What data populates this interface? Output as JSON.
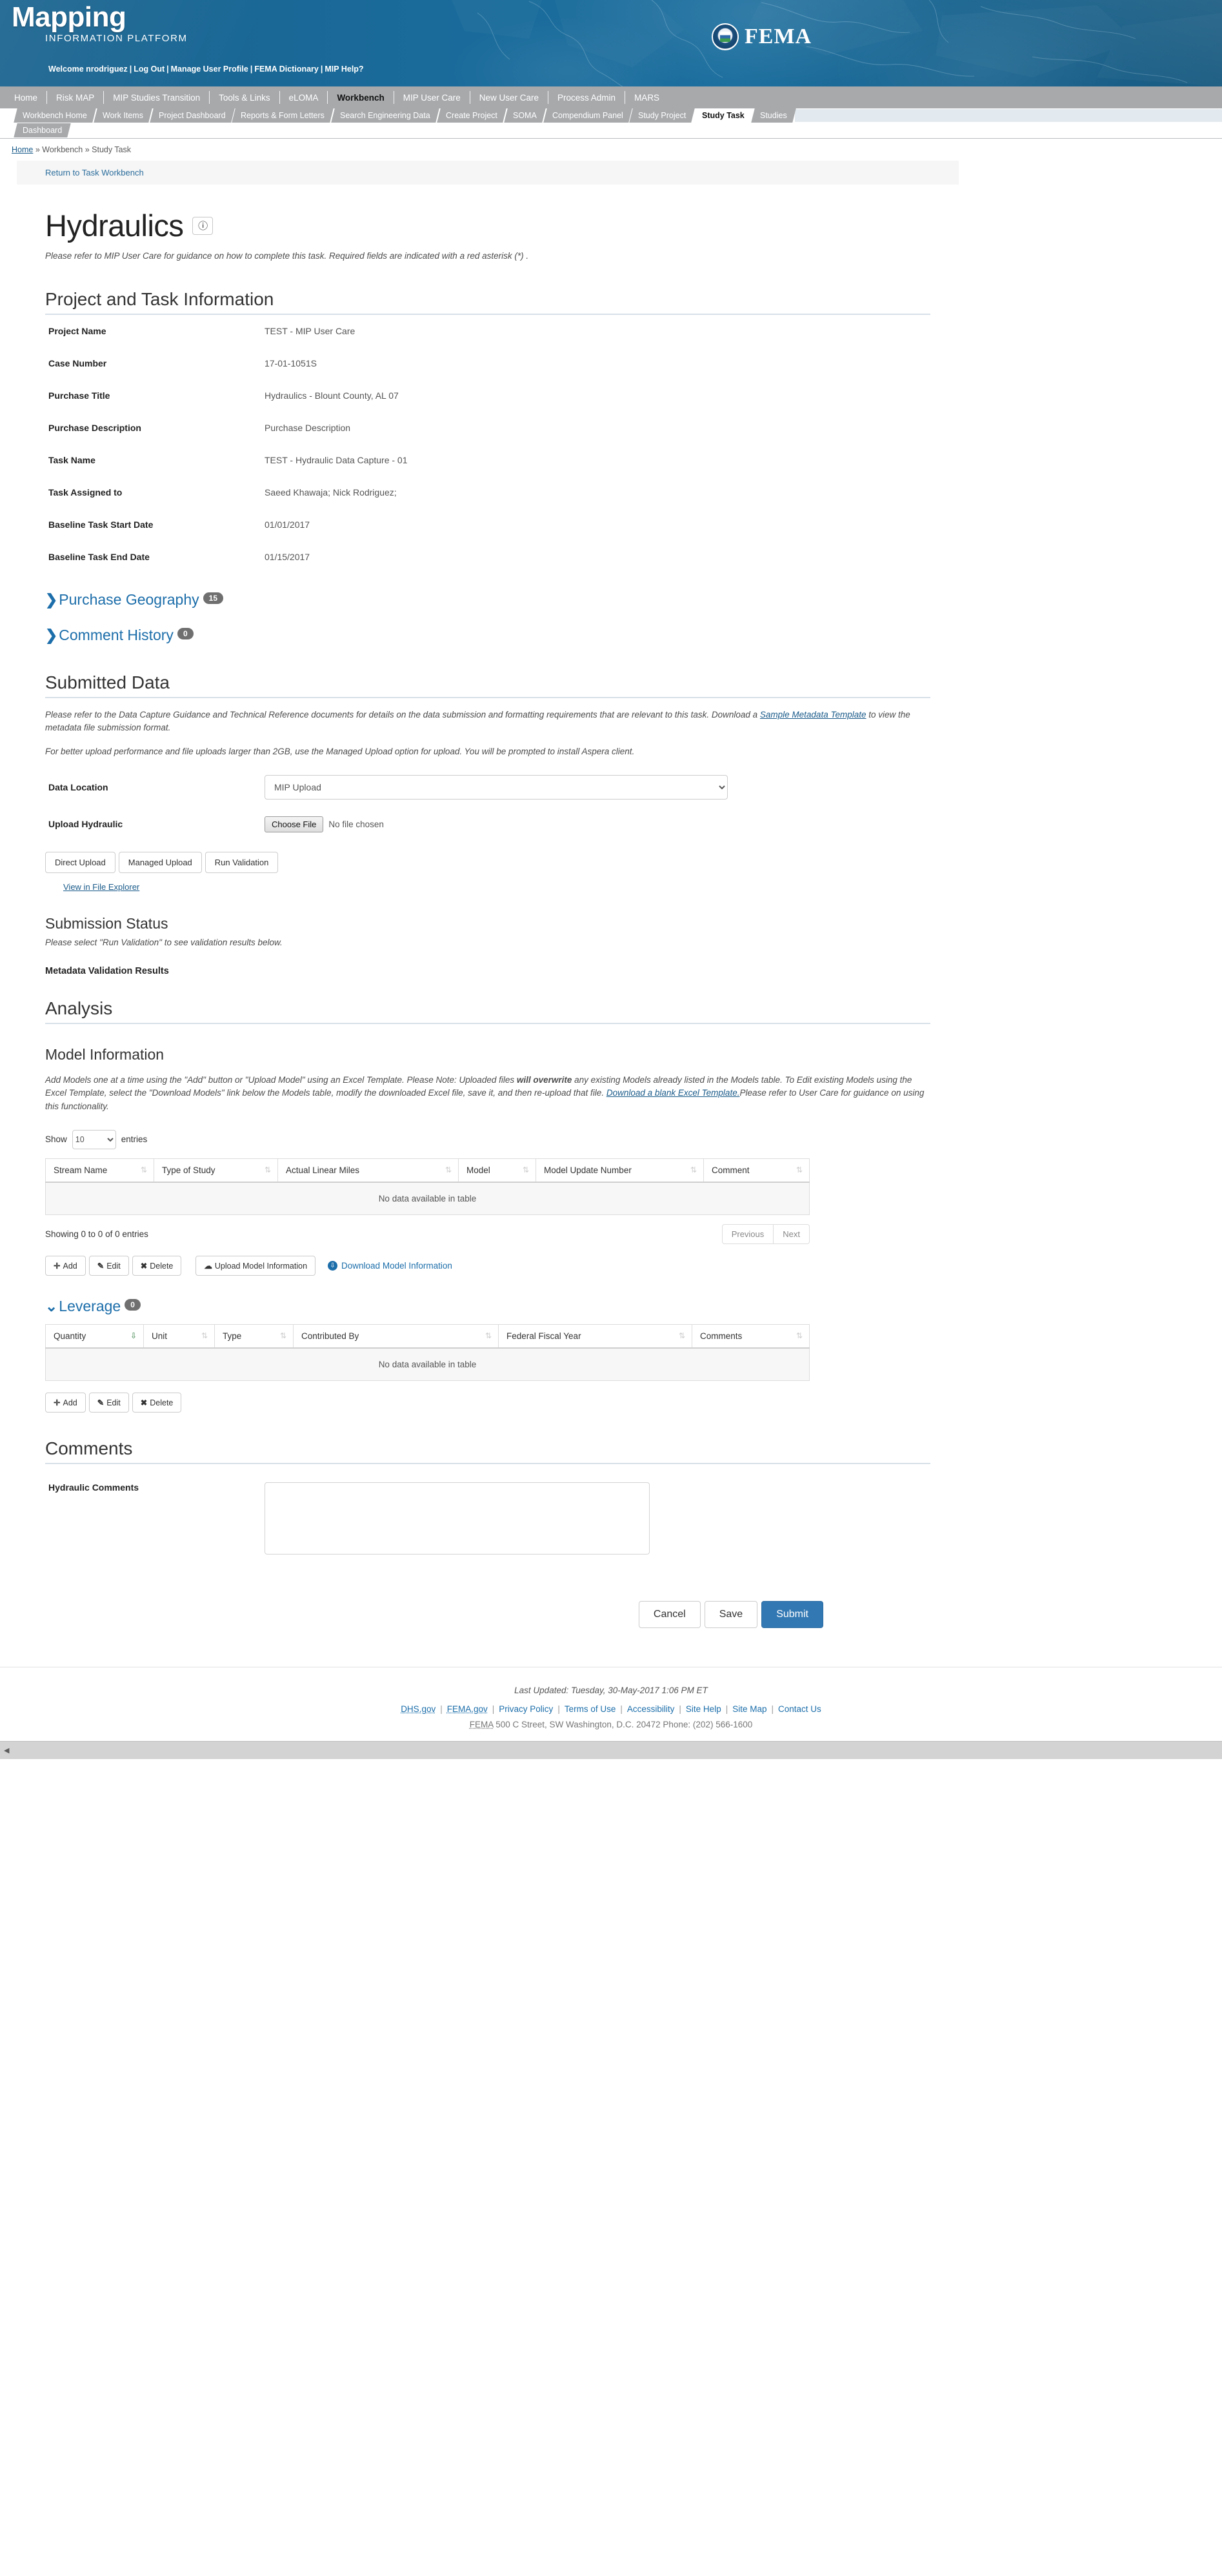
{
  "banner": {
    "brand_main": "Mapping",
    "brand_sub": "INFORMATION PLATFORM",
    "welcome": "Welcome nrodriguez",
    "logout": "Log Out",
    "manage_profile": "Manage User Profile",
    "fema_dictionary": "FEMA Dictionary",
    "mip_help": "MIP Help?",
    "agency": "FEMA"
  },
  "mainnav": [
    {
      "label": "Home",
      "active": false
    },
    {
      "label": "Risk MAP",
      "active": false
    },
    {
      "label": "MIP Studies Transition",
      "active": false
    },
    {
      "label": "Tools & Links",
      "active": false
    },
    {
      "label": "eLOMA",
      "active": false
    },
    {
      "label": "Workbench",
      "active": true
    },
    {
      "label": "MIP User Care",
      "active": false
    },
    {
      "label": "New User Care",
      "active": false
    },
    {
      "label": "Process Admin",
      "active": false
    },
    {
      "label": "MARS",
      "active": false
    }
  ],
  "subnav": [
    {
      "label": "Workbench Home",
      "active": false
    },
    {
      "label": "Work Items",
      "active": false
    },
    {
      "label": "Project Dashboard",
      "active": false
    },
    {
      "label": "Reports & Form Letters",
      "active": false
    },
    {
      "label": "Search Engineering Data",
      "active": false
    },
    {
      "label": "Create Project",
      "active": false
    },
    {
      "label": "SOMA",
      "active": false
    },
    {
      "label": "Compendium Panel",
      "active": false
    },
    {
      "label": "Study Project",
      "active": false
    },
    {
      "label": "Study Task",
      "active": true
    },
    {
      "label": "Studies",
      "active": false
    },
    {
      "label": "Dashboard",
      "active": false
    }
  ],
  "breadcrumb": {
    "home": "Home",
    "trail": "» Workbench » Study Task"
  },
  "return_bar": {
    "label": "Return to Task Workbench"
  },
  "page": {
    "title": "Hydraulics",
    "help_icon": "?",
    "lede": "Please refer to MIP User Care for guidance on how to complete this task. Required fields are indicated with a red asterisk (*) ."
  },
  "project_section": {
    "heading": "Project and Task Information",
    "fields": [
      {
        "label": "Project Name",
        "value": "TEST - MIP User Care"
      },
      {
        "label": "Case Number",
        "value": "17-01-1051S"
      },
      {
        "label": "Purchase Title",
        "value": "Hydraulics - Blount County, AL 07"
      },
      {
        "label": "Purchase Description",
        "value": "Purchase Description"
      },
      {
        "label": "Task Name",
        "value": "TEST - Hydraulic Data Capture - 01"
      },
      {
        "label": "Task Assigned to",
        "value": "Saeed Khawaja; Nick Rodriguez;"
      },
      {
        "label": "Baseline Task Start Date",
        "value": "01/01/2017"
      },
      {
        "label": "Baseline Task End Date",
        "value": "01/15/2017"
      }
    ]
  },
  "accordions": [
    {
      "label": "Purchase Geography",
      "count": "15",
      "caret": "❯"
    },
    {
      "label": "Comment History",
      "count": "0",
      "caret": "❯"
    }
  ],
  "submitted_data": {
    "heading": "Submitted Data",
    "note1_a": "Please refer to the Data Capture Guidance and Technical Reference documents for details on the data submission and formatting requirements that are relevant to this task. Download a ",
    "note1_link": "Sample Metadata Template",
    "note1_b": " to view the metadata file submission format.",
    "note2": "For better upload performance and file uploads larger than 2GB, use the Managed Upload option for upload. You will be prompted to install Aspera client.",
    "data_location_label": "Data Location",
    "data_location_value": "MIP Upload",
    "upload_label": "Upload Hydraulic",
    "choose_file_label": "Choose File",
    "no_file_text": "No file chosen",
    "buttons": [
      "Direct Upload",
      "Managed Upload",
      "Run Validation"
    ],
    "file_explorer_link": "View in File Explorer"
  },
  "submission_status": {
    "heading": "Submission Status",
    "note": "Please select \"Run Validation\" to see validation results below.",
    "metadata_heading": "Metadata Validation Results"
  },
  "analysis": {
    "heading": "Analysis",
    "model_heading": "Model Information",
    "model_note_a": "Add Models one at a time using the \"Add\" button or \"Upload Model\" using an Excel Template. Please Note: Uploaded files ",
    "model_note_bold": "will overwrite",
    "model_note_b": " any existing Models already listed in the Models table. To Edit existing Models using the Excel Template, select the \"Download Models\" link below the Models table, modify the downloaded Excel file, save it, and then re-upload that file. ",
    "model_note_link": "Download a blank Excel Template.",
    "model_note_c": "Please refer to User Care for guidance on using this functionality."
  },
  "models_table": {
    "show_label": "Show",
    "entries_label": "entries",
    "page_length": "10",
    "columns": [
      "Stream Name",
      "Type of Study",
      "Actual Linear Miles",
      "Model",
      "Model Update Number",
      "Comment"
    ],
    "empty_text": "No data available in table",
    "rows": [],
    "info": "Showing 0 to 0 of 0 entries",
    "prev": "Previous",
    "next": "Next",
    "actions": [
      "Add",
      "Edit",
      "Delete"
    ],
    "upload_label": "Upload Model Information",
    "download_label": "Download Model Information"
  },
  "leverage": {
    "label": "Leverage",
    "count": "0",
    "caret": "⌄",
    "columns": [
      "Quantity",
      "Unit",
      "Type",
      "Contributed By",
      "Federal Fiscal Year",
      "Comments"
    ],
    "empty_text": "No data available in table",
    "rows": [],
    "actions": [
      "Add",
      "Edit",
      "Delete"
    ]
  },
  "comments": {
    "heading": "Comments",
    "field_label": "Hydraulic Comments",
    "value": ""
  },
  "footer_actions": {
    "cancel": "Cancel",
    "save": "Save",
    "submit": "Submit"
  },
  "footer": {
    "last_updated": "Last Updated: Tuesday, 30-May-2017 1:06 PM ET",
    "links": [
      "DHS.gov",
      "FEMA.gov",
      "Privacy Policy",
      "Terms of Use",
      "Accessibility",
      "Site Help",
      "Site Map",
      "Contact Us"
    ],
    "address_abbr": "FEMA",
    "address_rest": " 500 C Street, SW Washington, D.C. 20472 Phone: (202) 566-1600"
  },
  "colors": {
    "banner_blue": "#1b6e9e",
    "nav_gray": "#a7a9ab",
    "link_blue": "#1c6eaa",
    "primary_button": "#3278b3"
  }
}
